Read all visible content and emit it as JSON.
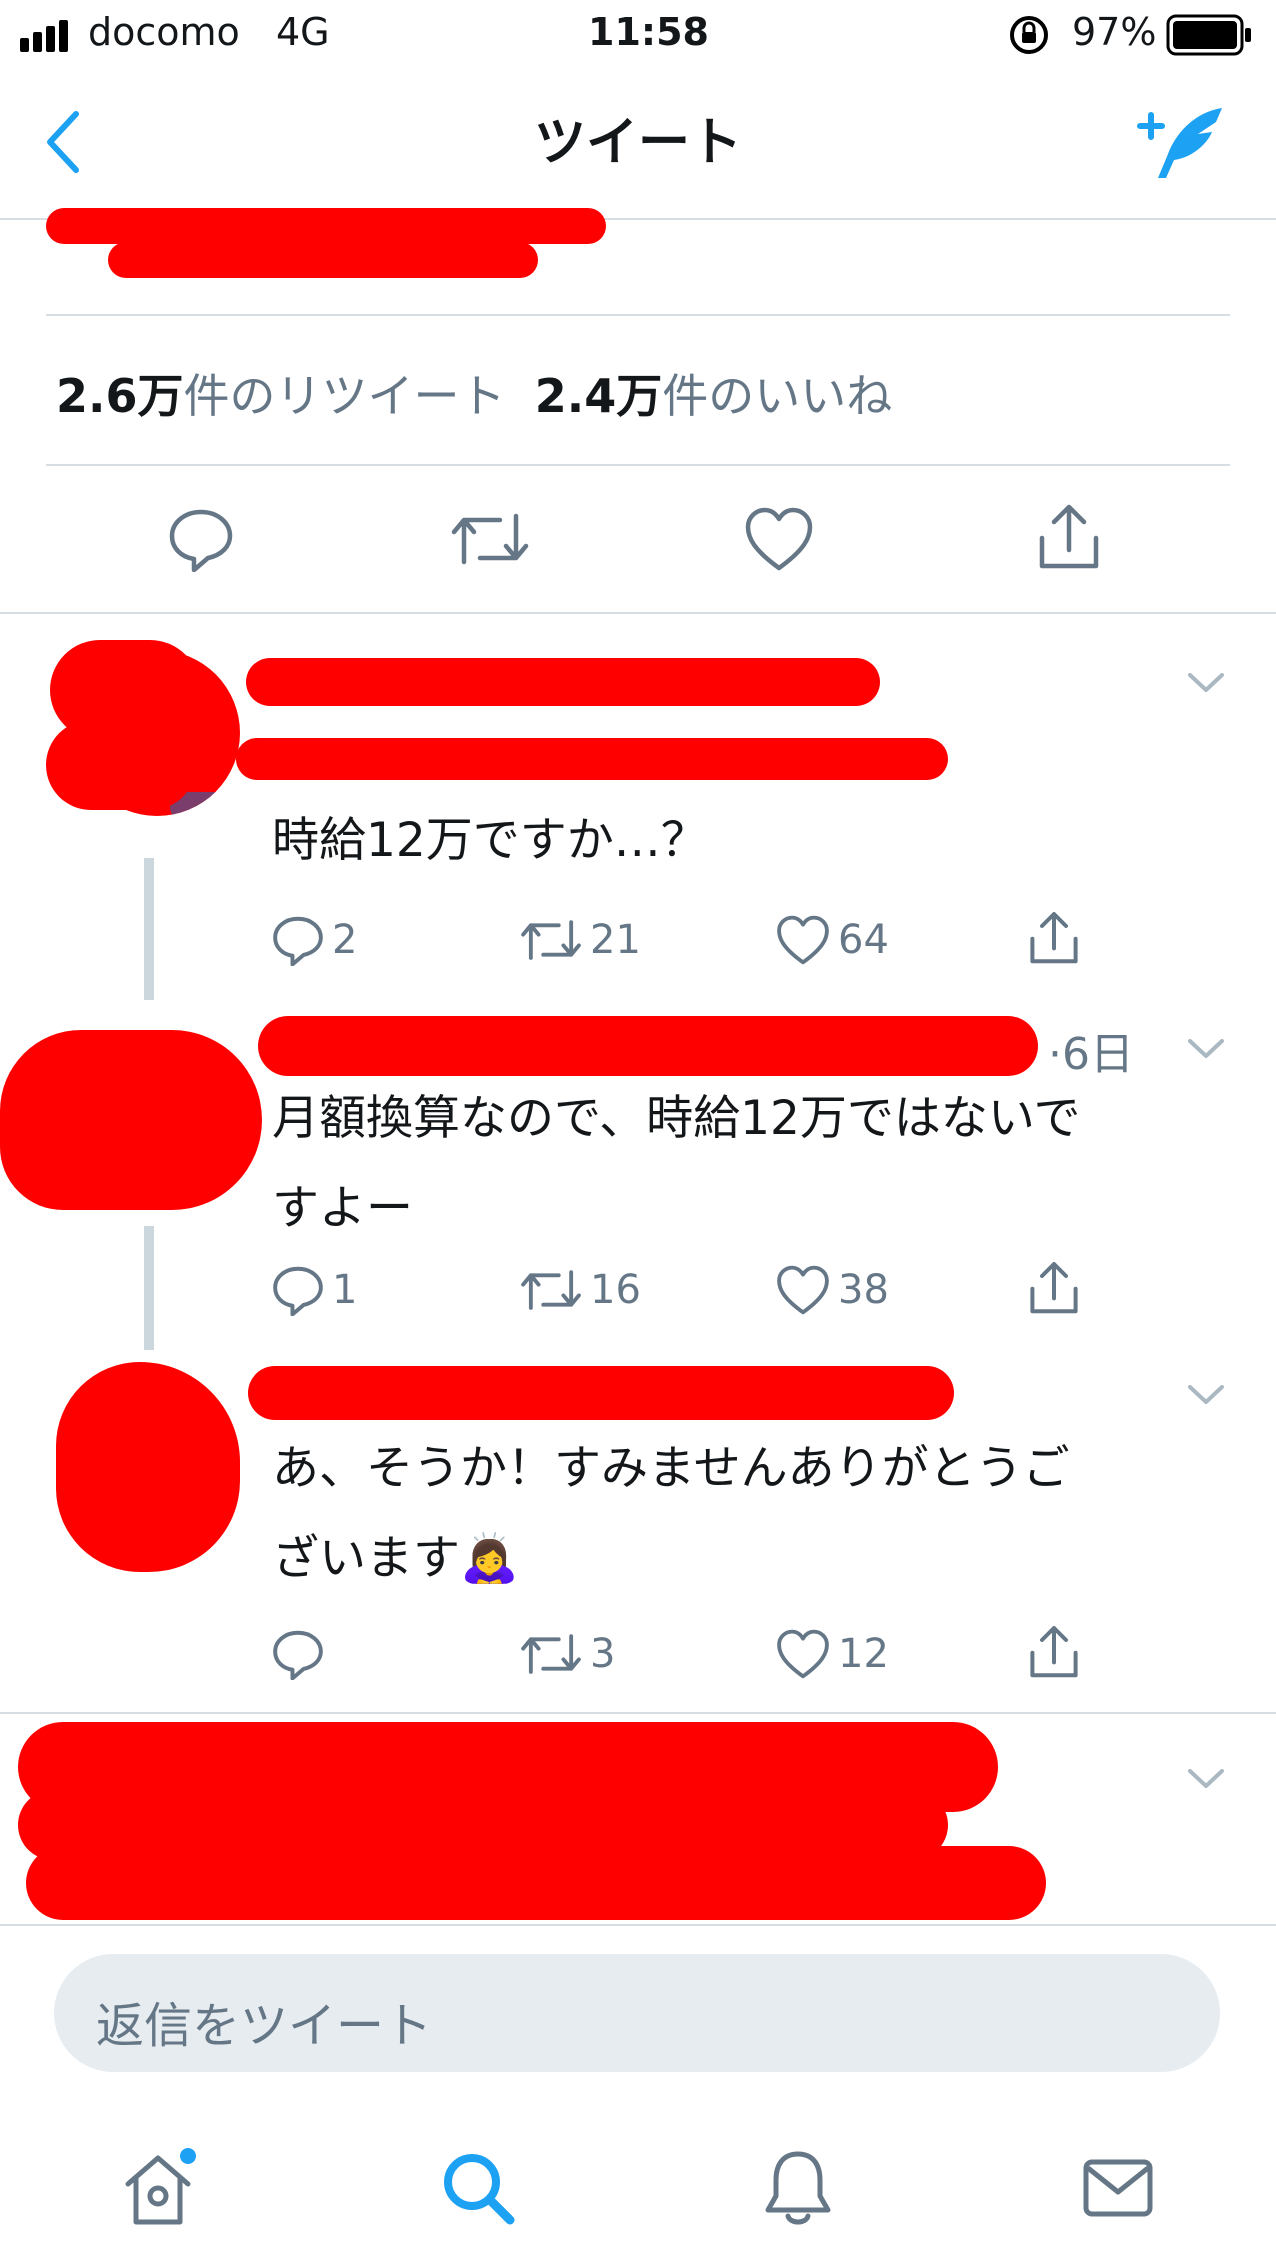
{
  "status_bar": {
    "carrier": "docomo",
    "network": "4G",
    "time": "11:58",
    "battery": "97%"
  },
  "nav": {
    "title": "ツイート",
    "back_icon": "chevron-left-icon",
    "compose_icon": "compose-tweet-icon"
  },
  "stats": {
    "retweets_value": "2.6万",
    "retweets_label": "件のリツイート",
    "likes_value": "2.4万",
    "likes_label": "件のいいね"
  },
  "replies": [
    {
      "text": "時給12万ですか…？",
      "reply_count": "2",
      "retweet_count": "21",
      "like_count": "64"
    },
    {
      "time": "·6日",
      "text_line1": "月額換算なので、時給12万ではないで",
      "text_line2": "すよー",
      "reply_count": "1",
      "retweet_count": "16",
      "like_count": "38"
    },
    {
      "text_line1": "あ、そうか！すみませんありがとうご",
      "text_line2": "ざいます",
      "emoji": "🙇‍♀️",
      "reply_count": "",
      "retweet_count": "3",
      "like_count": "12"
    }
  ],
  "reply_input": {
    "placeholder": "返信をツイート"
  },
  "tab_bar": {
    "items": [
      "home-icon",
      "search-icon",
      "notifications-icon",
      "messages-icon"
    ],
    "active": "search-icon"
  },
  "colors": {
    "accent": "#1da1f2",
    "secondary_text": "#657786",
    "divider": "#d6dde3",
    "redaction": "#ff0000"
  }
}
